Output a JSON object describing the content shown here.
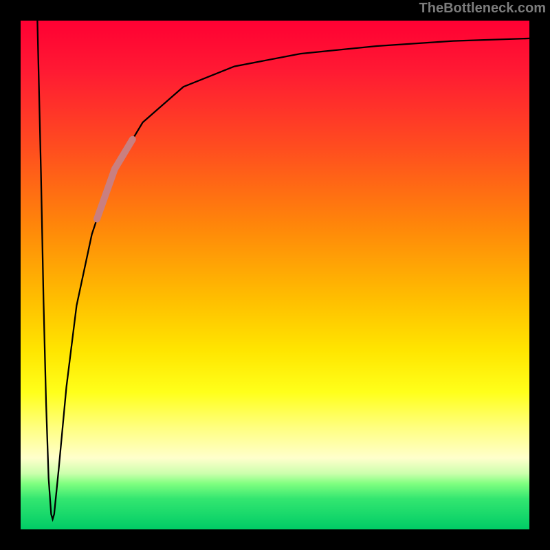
{
  "attribution": "TheBottleneck.com",
  "chart_data": {
    "type": "line",
    "title": "",
    "xlabel": "",
    "ylabel": "",
    "xlim": [
      0,
      100
    ],
    "ylim": [
      0,
      100
    ],
    "curve": [
      [
        3.3,
        100
      ],
      [
        4.0,
        70
      ],
      [
        4.5,
        45
      ],
      [
        5.0,
        25
      ],
      [
        5.5,
        10
      ],
      [
        6.0,
        3
      ],
      [
        6.3,
        2
      ],
      [
        6.6,
        3
      ],
      [
        7.5,
        12
      ],
      [
        9.0,
        28
      ],
      [
        11.0,
        44
      ],
      [
        14.0,
        58
      ],
      [
        18.0,
        70
      ],
      [
        24.0,
        80
      ],
      [
        32.0,
        87
      ],
      [
        42.0,
        91
      ],
      [
        55.0,
        93.5
      ],
      [
        70.0,
        95
      ],
      [
        85.0,
        96
      ],
      [
        100.0,
        96.5
      ]
    ],
    "highlight_range": [
      15,
      22
    ],
    "background_gradient_note": "vertical rainbow red->orange->yellow->green"
  }
}
